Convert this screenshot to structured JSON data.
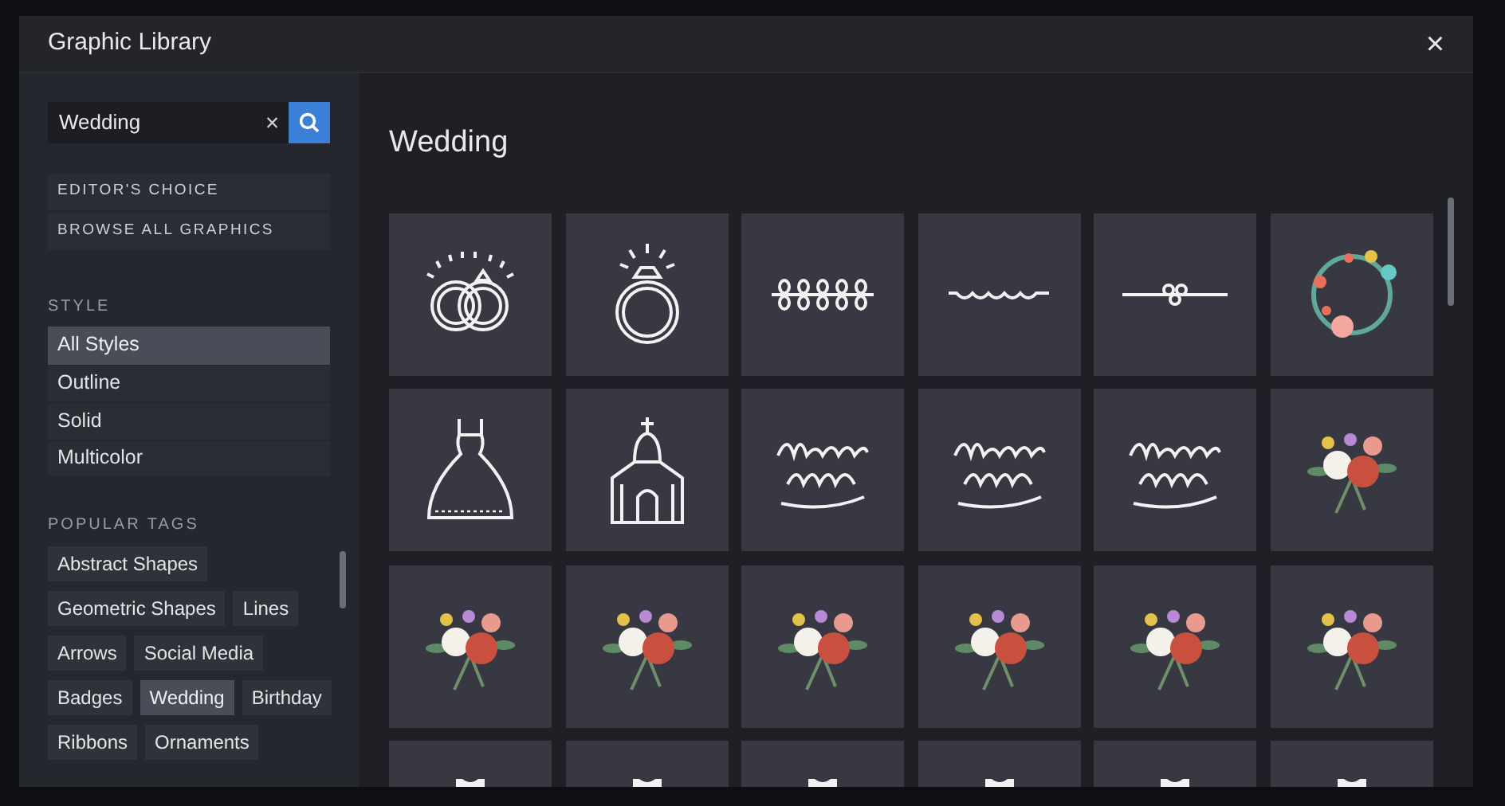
{
  "window": {
    "title": "Graphic Library",
    "close": "×"
  },
  "search": {
    "value": "Wedding",
    "clear": "×"
  },
  "quick_links": [
    "EDITOR'S CHOICE",
    "BROWSE ALL GRAPHICS"
  ],
  "style": {
    "heading": "STYLE",
    "items": [
      {
        "label": "All Styles",
        "selected": true
      },
      {
        "label": "Outline",
        "selected": false
      },
      {
        "label": "Solid",
        "selected": false
      },
      {
        "label": "Multicolor",
        "selected": false
      }
    ]
  },
  "popular_tags": {
    "heading": "POPULAR TAGS",
    "items": [
      {
        "label": "Abstract Shapes",
        "selected": false
      },
      {
        "label": "Geometric Shapes",
        "selected": false
      },
      {
        "label": "Lines",
        "selected": false
      },
      {
        "label": "Arrows",
        "selected": false
      },
      {
        "label": "Social Media",
        "selected": false
      },
      {
        "label": "Badges",
        "selected": false
      },
      {
        "label": "Wedding",
        "selected": true
      },
      {
        "label": "Birthday",
        "selected": false
      },
      {
        "label": "Ribbons",
        "selected": false
      },
      {
        "label": "Ornaments",
        "selected": false
      }
    ]
  },
  "results": {
    "title": "Wedding",
    "tiles": [
      {
        "kind": "rings"
      },
      {
        "kind": "ring"
      },
      {
        "kind": "laurel"
      },
      {
        "kind": "divider"
      },
      {
        "kind": "ornament"
      },
      {
        "kind": "wreath"
      },
      {
        "kind": "dress"
      },
      {
        "kind": "chapel"
      },
      {
        "kind": "lettering"
      },
      {
        "kind": "lettering"
      },
      {
        "kind": "lettering"
      },
      {
        "kind": "bouquet"
      },
      {
        "kind": "bouquet"
      },
      {
        "kind": "bouquet"
      },
      {
        "kind": "bouquet"
      },
      {
        "kind": "bouquet"
      },
      {
        "kind": "bouquet"
      },
      {
        "kind": "bouquet"
      },
      {
        "kind": "partial"
      },
      {
        "kind": "partial"
      },
      {
        "kind": "partial"
      },
      {
        "kind": "partial"
      },
      {
        "kind": "partial"
      },
      {
        "kind": "partial"
      }
    ]
  }
}
